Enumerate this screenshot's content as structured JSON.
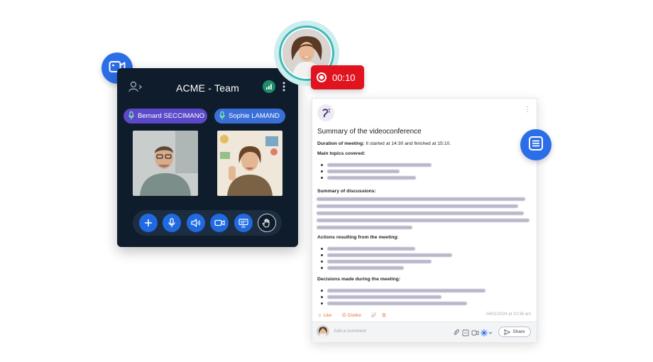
{
  "call_panel": {
    "title": "ACME  - Team",
    "participants": [
      {
        "name": "Bernard SECCIMANO"
      },
      {
        "name": "Sophie LAMAND"
      }
    ],
    "controls": [
      "add-icon",
      "microphone-icon",
      "speaker-icon",
      "camera-icon",
      "screen-share-icon",
      "raise-hand-icon"
    ]
  },
  "recording": {
    "time": "00:10",
    "color": "#e0141e"
  },
  "summary": {
    "title": "Summary of the videoconference",
    "duration_label": "Duration of meeting:",
    "duration_value": " It started at 14:30 and finished at 15:10.",
    "main_topics_heading": "Main topics covered:",
    "discussions_heading": "Summary of discussions:",
    "actions_heading": "Actions resulting from the meeting:",
    "decisions_heading": "Decisions made during the meeting:",
    "like_label": "Like",
    "dislike_label": "Dislike",
    "date": "04/01/2024 at 10:36 am",
    "comment_placeholder": "Add a comment",
    "share_label": "Share"
  },
  "colors": {
    "accent": "#2c6ee8",
    "panel_bg": "#0e1c2b",
    "teal": "#3fb8b6",
    "action_orange": "#e8732c"
  }
}
